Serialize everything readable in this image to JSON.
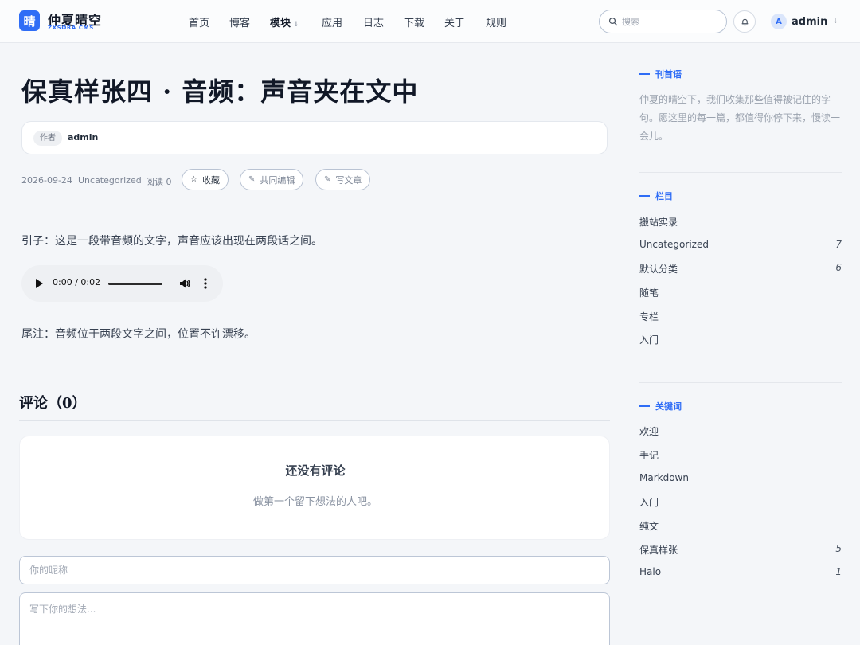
{
  "brand": {
    "logo_char": "晴",
    "title": "仲夏晴空",
    "subtitle": "ZXSORA CMS",
    "accent": "#2f6df6"
  },
  "nav": [
    {
      "label": "首页"
    },
    {
      "label": "博客"
    },
    {
      "label": "模块",
      "active": true,
      "caret": "↓"
    },
    {
      "label": "应用"
    },
    {
      "label": "日志"
    },
    {
      "label": "下载"
    },
    {
      "label": "关于"
    },
    {
      "label": "规则"
    }
  ],
  "search": {
    "placeholder": "搜索"
  },
  "user": {
    "avatar_letter": "A",
    "name": "admin",
    "caret": "↓"
  },
  "article": {
    "title": "保真样张四 · 音频：声音夹在文中",
    "author_label": "作者",
    "author_name": "admin",
    "date": "2026-09-24",
    "category": "Uncategorized",
    "reads": "阅读 0",
    "actions": {
      "favorite": "收藏",
      "co_edit": "共同编辑",
      "write": "写文章"
    },
    "intro": "引子：这是一段带音频的文字，声音应该出现在两段话之间。",
    "audio_time": "0:00 / 0:02",
    "outro": "尾注：音频位于两段文字之间，位置不许漂移。"
  },
  "comments": {
    "title": "评论（0）",
    "empty_title": "还没有评论",
    "empty_sub": "做第一个留下想法的人吧。",
    "nick_placeholder": "你的昵称",
    "body_placeholder": "写下你的想法..."
  },
  "sidebar": {
    "motto_title": "刊首语",
    "motto_text": "仲夏的晴空下，我们收集那些值得被记住的字句。愿这里的每一篇，都值得你停下来，慢读一会儿。",
    "categories_title": "栏目",
    "categories": [
      {
        "label": "搬站实录",
        "count": ""
      },
      {
        "label": "Uncategorized",
        "count": "7"
      },
      {
        "label": "默认分类",
        "count": "6"
      },
      {
        "label": "随笔",
        "count": ""
      },
      {
        "label": "专栏",
        "count": ""
      },
      {
        "label": "入门",
        "count": ""
      }
    ],
    "tags_title": "关键词",
    "tags": [
      {
        "label": "欢迎",
        "count": ""
      },
      {
        "label": "手记",
        "count": ""
      },
      {
        "label": "Markdown",
        "count": ""
      },
      {
        "label": "入门",
        "count": ""
      },
      {
        "label": "纯文",
        "count": ""
      },
      {
        "label": "保真样张",
        "count": "5"
      },
      {
        "label": "Halo",
        "count": "1"
      }
    ]
  }
}
